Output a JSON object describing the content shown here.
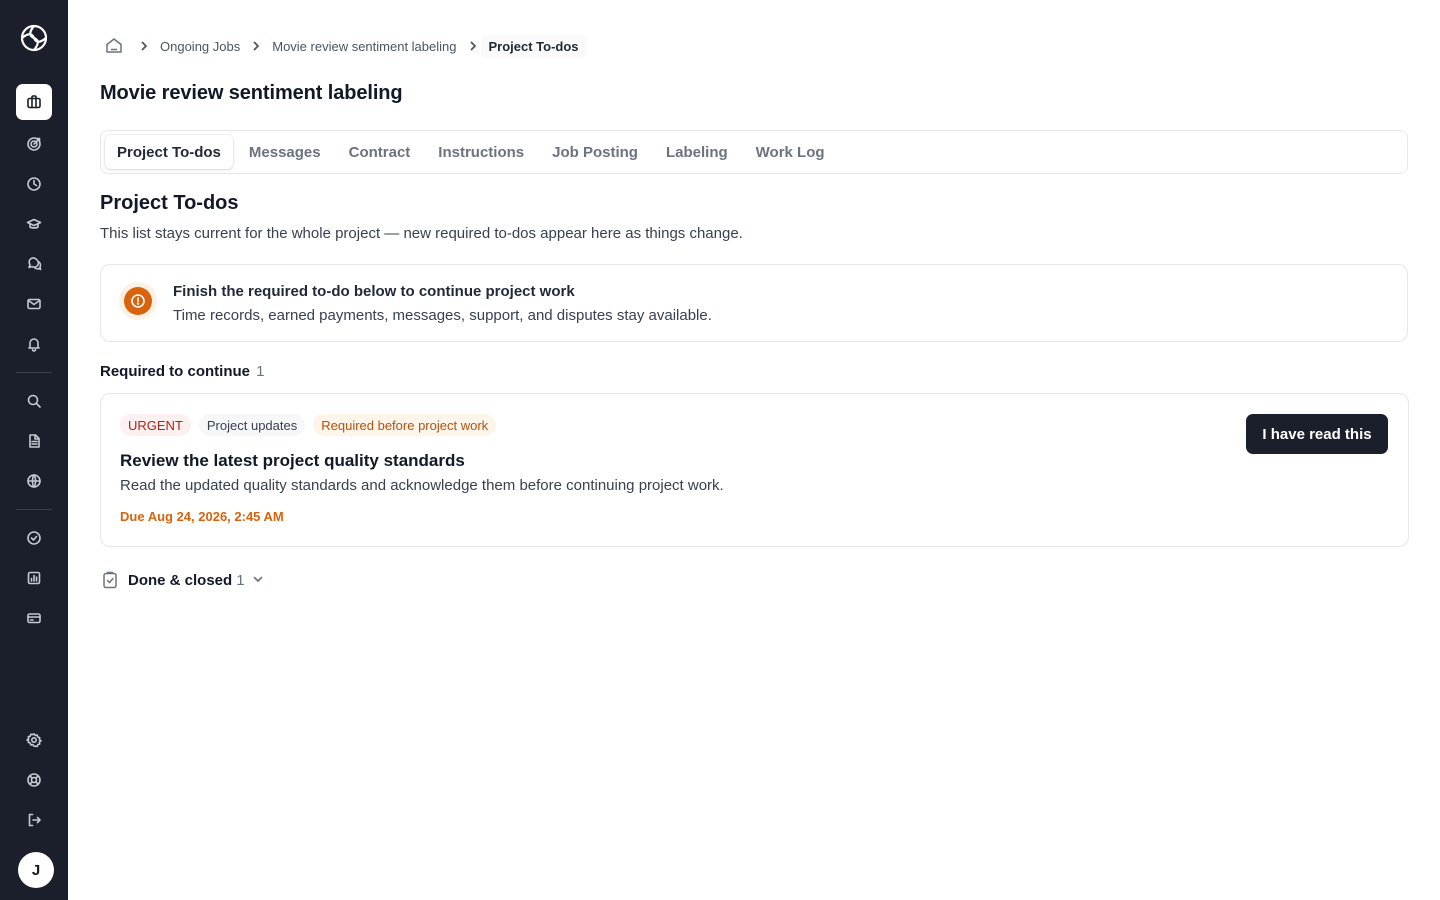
{
  "user": {
    "avatar_initial": "J"
  },
  "sidebar": {
    "items": [
      {
        "name": "jobs",
        "icon": "briefcase-icon",
        "active": true
      },
      {
        "name": "goals",
        "icon": "target-icon",
        "active": false
      },
      {
        "name": "history",
        "icon": "clock-icon",
        "active": false
      },
      {
        "name": "learning",
        "icon": "graduation-cap-icon",
        "active": false
      },
      {
        "name": "discussions",
        "icon": "chat-bubbles-icon",
        "active": false
      },
      {
        "name": "messages",
        "icon": "mail-icon",
        "active": false
      },
      {
        "name": "notifications",
        "icon": "bell-icon",
        "active": false
      },
      {
        "name": "search",
        "icon": "search-icon",
        "active": false
      },
      {
        "name": "documents",
        "icon": "document-icon",
        "active": false
      },
      {
        "name": "explore",
        "icon": "globe-icon",
        "active": false
      },
      {
        "name": "completed",
        "icon": "check-circle-icon",
        "active": false
      },
      {
        "name": "analytics",
        "icon": "bar-chart-icon",
        "active": false
      },
      {
        "name": "payments",
        "icon": "credit-card-icon",
        "active": false
      },
      {
        "name": "settings",
        "icon": "gear-icon",
        "active": false
      },
      {
        "name": "help",
        "icon": "lifebuoy-icon",
        "active": false
      },
      {
        "name": "logout",
        "icon": "logout-icon",
        "active": false
      }
    ]
  },
  "breadcrumb": {
    "items": [
      "Ongoing Jobs",
      "Movie review sentiment labeling"
    ],
    "current": "Project To-dos"
  },
  "page": {
    "title": "Movie review sentiment labeling"
  },
  "tabs": [
    {
      "label": "Project To-dos",
      "active": true
    },
    {
      "label": "Messages",
      "active": false
    },
    {
      "label": "Contract",
      "active": false
    },
    {
      "label": "Instructions",
      "active": false
    },
    {
      "label": "Job Posting",
      "active": false
    },
    {
      "label": "Labeling",
      "active": false
    },
    {
      "label": "Work Log",
      "active": false
    }
  ],
  "todos": {
    "title": "Project To-dos",
    "description": "This list stays current for the whole project — new required to-dos appear here as things change.",
    "alert": {
      "title": "Finish the required to-do below to continue project work",
      "subtitle": "Time records, earned payments, messages, support, and disputes stay available.",
      "icon": "alert-circle-icon",
      "color": "#d9620c"
    },
    "required": {
      "heading": "Required to continue",
      "count": "1",
      "items": [
        {
          "badges": {
            "priority": "URGENT",
            "category": "Project updates",
            "requirement": "Required before project work"
          },
          "title": "Review the latest project quality standards",
          "description": "Read the updated quality standards and acknowledge them before continuing project work.",
          "due": "Due Aug 24, 2026, 2:45 AM",
          "action_label": "I have read this"
        }
      ]
    },
    "done": {
      "label": "Done & closed",
      "count": "1"
    }
  },
  "colors": {
    "sidebar_bg": "#1a1f2b",
    "accent_orange": "#d9620c",
    "urgent_red": "#b42318",
    "primary_button": "#1a1f2b"
  }
}
